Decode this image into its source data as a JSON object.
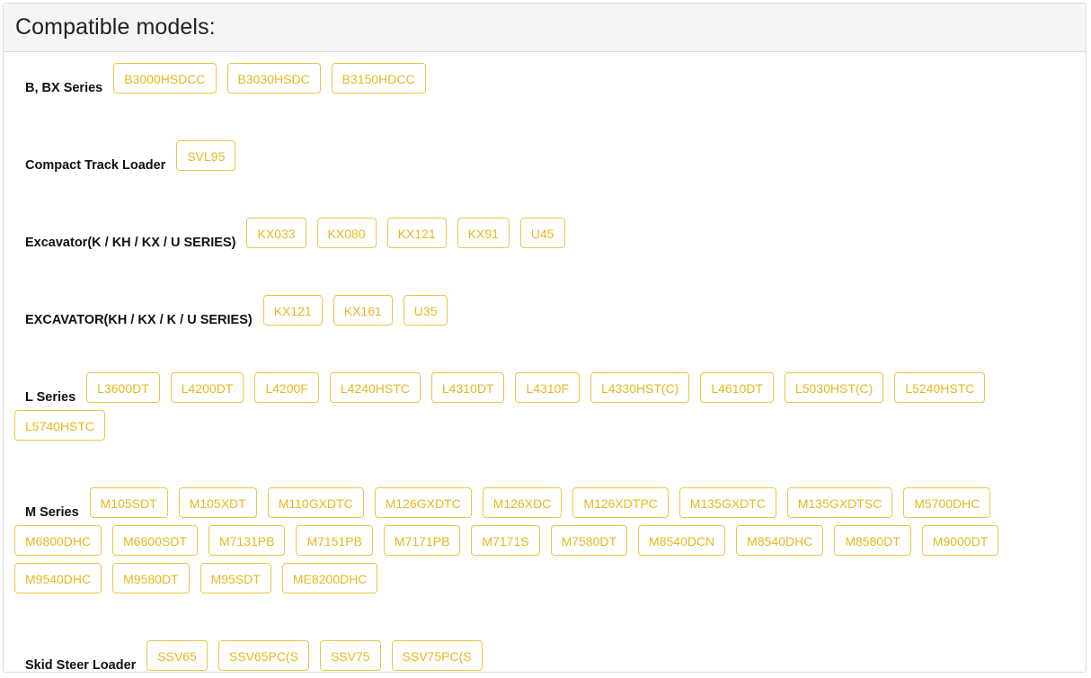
{
  "panel": {
    "title": "Compatible models:"
  },
  "groups": [
    {
      "label": "B, BX Series",
      "models": [
        "B3000HSDCC",
        "B3030HSDC",
        "B3150HDCC"
      ]
    },
    {
      "label": "Compact Track Loader",
      "models": [
        "SVL95"
      ]
    },
    {
      "label": "Excavator(K / KH / KX / U SERIES)",
      "models": [
        "KX033",
        "KX080",
        "KX121",
        "KX91",
        "U45"
      ]
    },
    {
      "label": "EXCAVATOR(KH / KX / K / U SERIES)",
      "models": [
        "KX121",
        "KX161",
        "U35"
      ]
    },
    {
      "label": "L Series",
      "models": [
        "L3600DT",
        "L4200DT",
        "L4200F",
        "L4240HSTC",
        "L4310DT",
        "L4310F",
        "L4330HST(C)",
        "L4610DT",
        "L5030HST(C)",
        "L5240HSTC",
        "L5740HSTC"
      ]
    },
    {
      "label": "M Series",
      "models": [
        "M105SDT",
        "M105XDT",
        "M110GXDTC",
        "M126GXDTC",
        "M126XDC",
        "M126XDTPC",
        "M135GXDTC",
        "M135GXDTSC",
        "M5700DHC",
        "M6800DHC",
        "M6800SDT",
        "M7131PB",
        "M7151PB",
        "M7171PB",
        "M7171S",
        "M7580DT",
        "M8540DCN",
        "M8540DHC",
        "M8580DT",
        "M9000DT",
        "M9540DHC",
        "M9580DT",
        "M95SDT",
        "ME8200DHC"
      ]
    },
    {
      "label": "Skid Steer Loader",
      "models": [
        "SSV65",
        "SSV65PC(S",
        "SSV75",
        "SSV75PC(S"
      ]
    }
  ],
  "colors": {
    "chip_border": "#ecc64a",
    "chip_text": "#e6b820",
    "header_bg": "#f5f5f5"
  }
}
